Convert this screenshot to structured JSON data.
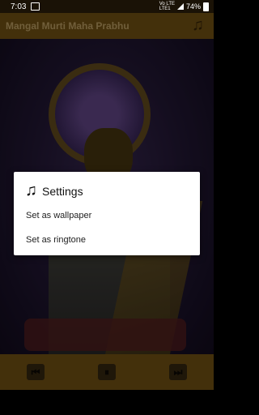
{
  "status": {
    "time": "7:03",
    "network_top": "Vo LTE",
    "network_bottom": "LTE1",
    "battery": "74%"
  },
  "app": {
    "title": "Mangal Murti Maha Prabhu",
    "music_icon": "music-note-icon"
  },
  "controls": {
    "prev": "previous-icon",
    "pause": "pause-icon",
    "next": "next-icon"
  },
  "dialog": {
    "title": "Settings",
    "icon": "music-note-icon",
    "items": [
      {
        "label": "Set as wallpaper"
      },
      {
        "label": "Set as ringtone"
      }
    ]
  },
  "colors": {
    "appbar": "#7a5814",
    "statusbar": "#1a1206",
    "dialog_bg": "#ffffff"
  }
}
